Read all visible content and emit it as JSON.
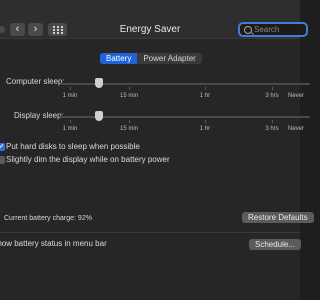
{
  "window": {
    "title": "Energy Saver"
  },
  "toolbar": {
    "back_glyph": "‹",
    "forward_glyph": "›",
    "search_placeholder": "Search"
  },
  "tabs": [
    {
      "label": "Battery",
      "active": true
    },
    {
      "label": "Power Adapter",
      "active": false
    }
  ],
  "sliders": {
    "computer_sleep": {
      "label": "Computer sleep:",
      "value_minutes": 10
    },
    "display_sleep": {
      "label": "Display sleep:",
      "value_minutes": 10
    },
    "tick_labels": [
      "1 min",
      "15 min",
      "1 hr",
      "3 hrs",
      "Never"
    ]
  },
  "options": {
    "hard_disks": {
      "label": "Put hard disks to sleep when possible",
      "checked": true
    },
    "dim_display": {
      "label": "Slightly dim the display while on battery power",
      "checked": false
    }
  },
  "battery": {
    "charge_text": "Current battery charge: 92%"
  },
  "buttons": {
    "restore_defaults": "Restore Defaults",
    "schedule": "Schedule..."
  },
  "menu_bar_option": {
    "label": "Show battery status in menu bar",
    "checked": true
  },
  "colors": {
    "accent": "#1f63d9",
    "background": "#262626"
  }
}
